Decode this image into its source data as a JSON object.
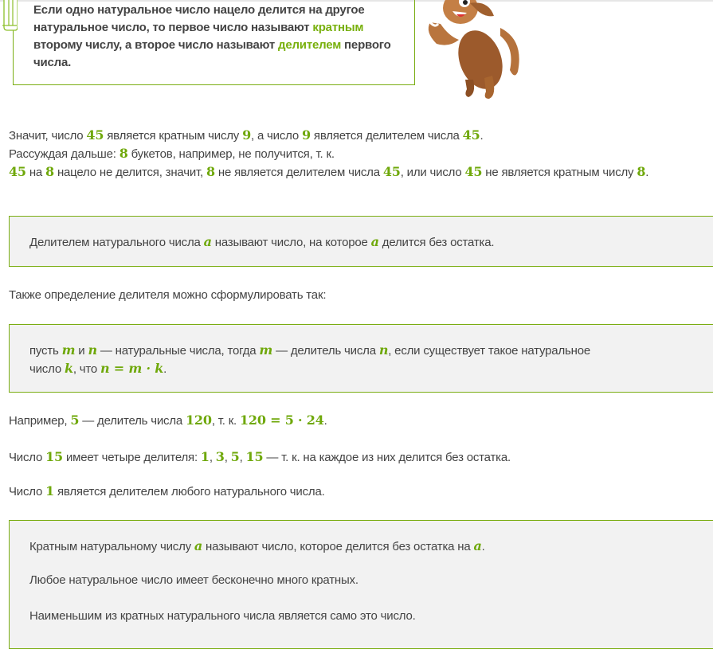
{
  "definition_card": {
    "segments": [
      {
        "t": "Если одно натуральное число нацело делится на другое натуральное число, то первое число называют "
      },
      {
        "g": "кратным"
      },
      {
        "t": " второму числу, а второе число называют "
      },
      {
        "g": "делителем"
      },
      {
        "t": " первого числа."
      }
    ]
  },
  "colors": {
    "accent": "#7aad12",
    "math": "#6fa80a",
    "text": "#444444",
    "box_bg": "#f2f2f2"
  },
  "icons": {
    "bookmark": "bookmark-icon",
    "mascot": "dog-mascot-illustration"
  },
  "paragraphs": [
    {
      "id": "explain",
      "segments": [
        {
          "t": "Значит, число "
        },
        {
          "m": "45"
        },
        {
          "t": " является кратным числу "
        },
        {
          "m": "9"
        },
        {
          "t": ", а число "
        },
        {
          "m": "9"
        },
        {
          "t": " является делителем числа "
        },
        {
          "m": "45"
        },
        {
          "t": "."
        },
        {
          "br": true
        },
        {
          "t": "Рассуждая дальше: "
        },
        {
          "m": "8"
        },
        {
          "t": " букетов, например, не получится, т. к."
        },
        {
          "br": true
        },
        {
          "m": "45"
        },
        {
          "t": " на "
        },
        {
          "m": "8"
        },
        {
          "t": " нацело не делится, значит, "
        },
        {
          "m": "8"
        },
        {
          "t": " не является делителем числа "
        },
        {
          "m": "45"
        },
        {
          "t": ", или число "
        },
        {
          "m": "45"
        },
        {
          "t": " не является кратным числу "
        },
        {
          "m": "8"
        },
        {
          "t": "."
        }
      ]
    },
    {
      "id": "box-divisor",
      "segments": [
        {
          "t": "Делителем натурального числа "
        },
        {
          "v": "a"
        },
        {
          "t": " называют число, на которое "
        },
        {
          "v": "a"
        },
        {
          "t": " делится без остатка."
        }
      ]
    },
    {
      "id": "also",
      "segments": [
        {
          "t": "Также определение делителя можно сформулировать так:"
        }
      ]
    },
    {
      "id": "box-formal",
      "segments": [
        {
          "t": "пусть "
        },
        {
          "v": "m"
        },
        {
          "t": " и "
        },
        {
          "v": "n"
        },
        {
          "t": " — натуральные числа, тогда "
        },
        {
          "v": "m"
        },
        {
          "t": " — делитель числа "
        },
        {
          "v": "n"
        },
        {
          "t": ", если существует такое натуральное"
        },
        {
          "br": true
        },
        {
          "t": "число "
        },
        {
          "v": "k"
        },
        {
          "t": ", что "
        },
        {
          "v": "n = m · k"
        },
        {
          "t": "."
        }
      ]
    },
    {
      "id": "example",
      "segments": [
        {
          "t": "Например, "
        },
        {
          "m": "5"
        },
        {
          "t": " — делитель числа "
        },
        {
          "m": "120"
        },
        {
          "t": ", т. к. "
        },
        {
          "m": "120 = 5 · 24"
        },
        {
          "t": "."
        }
      ]
    },
    {
      "id": "fifteen",
      "segments": [
        {
          "t": "Число "
        },
        {
          "m": "15"
        },
        {
          "t": " имеет четыре делителя: "
        },
        {
          "m": "1"
        },
        {
          "t": ", "
        },
        {
          "m": "3"
        },
        {
          "t": ", "
        },
        {
          "m": "5"
        },
        {
          "t": ", "
        },
        {
          "m": "15"
        },
        {
          "t": " — т. к. на каждое из них делится без остатка."
        }
      ]
    },
    {
      "id": "one",
      "segments": [
        {
          "t": "Число "
        },
        {
          "m": "1"
        },
        {
          "t": " является делителем любого натурального числа."
        }
      ]
    },
    {
      "id": "box-multiple-1",
      "segments": [
        {
          "t": "Кратным натуральному числу "
        },
        {
          "v": "a"
        },
        {
          "t": " называют число, которое делится без остатка на "
        },
        {
          "v": "a"
        },
        {
          "t": "."
        }
      ]
    },
    {
      "id": "box-multiple-2",
      "segments": [
        {
          "t": "Любое натуральное число имеет бесконечно много кратных."
        }
      ]
    },
    {
      "id": "box-multiple-3",
      "segments": [
        {
          "t": "Наименьшим из кратных натурального числа является само это число."
        }
      ]
    }
  ]
}
